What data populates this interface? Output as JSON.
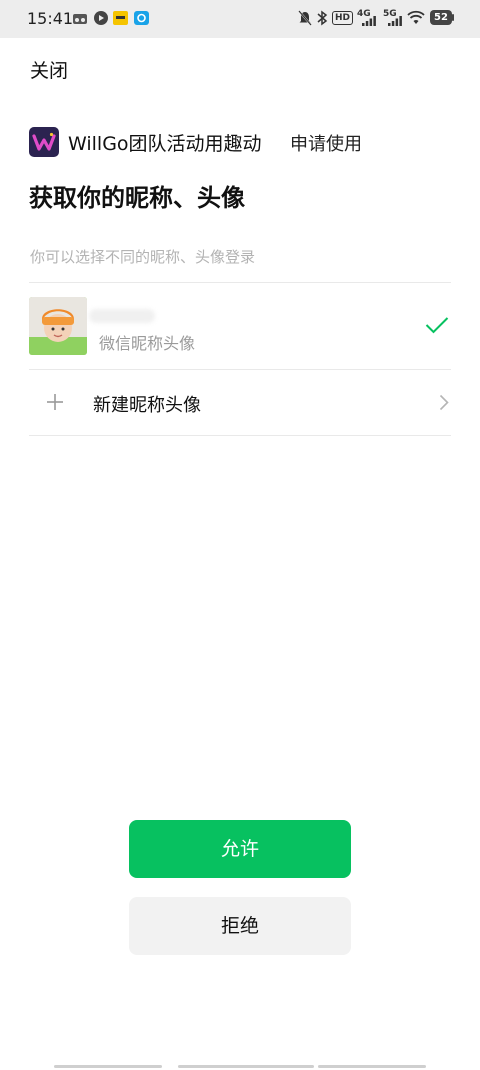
{
  "status_bar": {
    "time": "15:41",
    "left_icons": [
      "cloud-icon",
      "play-icon",
      "app-badge-icon",
      "browser-icon"
    ],
    "right_icons": [
      "mute-bell-icon",
      "bluetooth-icon",
      "hd-icon",
      "signal-4g-icon",
      "signal-5g-icon",
      "wifi-icon",
      "battery-icon"
    ],
    "hd_label": "HD",
    "net1_label": "4G",
    "net2_label": "5G",
    "battery_level": "52"
  },
  "header": {
    "close_label": "关闭"
  },
  "app": {
    "name": "WillGo团队活动用趣动",
    "apply_label": "申请使用",
    "logo_icon": "willgo-logo-icon",
    "logo_colors": [
      "#2b2350",
      "#e04cc8",
      "#f4c430"
    ]
  },
  "main": {
    "title": "获取你的昵称、头像",
    "hint": "你可以选择不同的昵称、头像登录"
  },
  "options": {
    "current": {
      "sub_label": "微信昵称头像",
      "selected": true,
      "check_icon": "checkmark-icon"
    },
    "new": {
      "label": "新建昵称头像",
      "plus_icon": "plus-icon",
      "chevron_icon": "chevron-right-icon"
    }
  },
  "actions": {
    "allow_label": "允许",
    "reject_label": "拒绝"
  },
  "colors": {
    "accent_green": "#07c160",
    "reject_bg": "#f2f2f2",
    "status_bar_bg": "#ededed"
  }
}
